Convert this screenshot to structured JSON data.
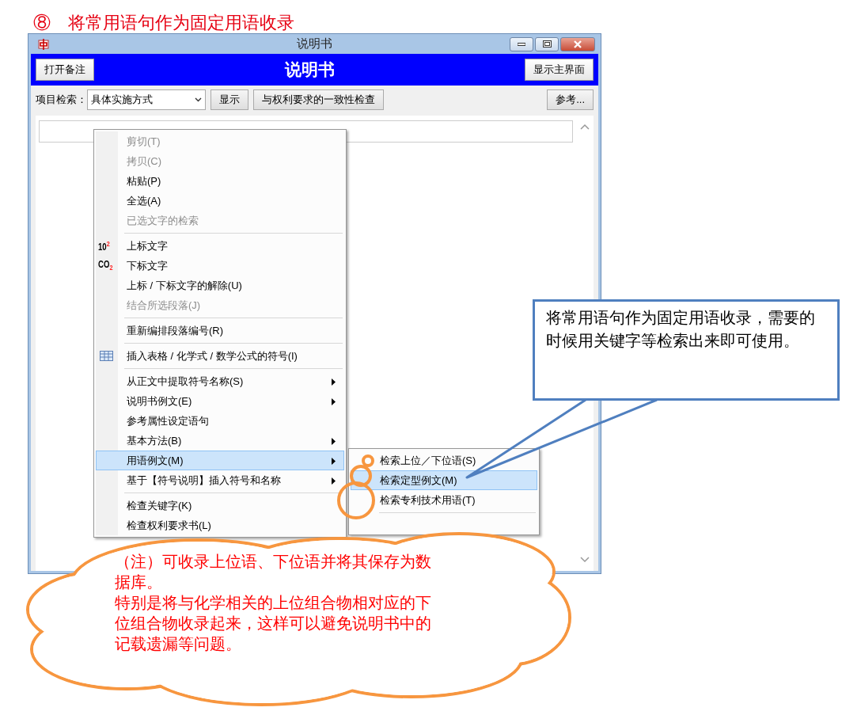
{
  "heading": "⑧　将常用语句作为固定用语收录",
  "window": {
    "title": "说明书"
  },
  "header": {
    "left_button": "打开备注",
    "title": "说明书",
    "right_button": "显示主界面"
  },
  "toolbar": {
    "label": "项目检索：",
    "select_value": "具体实施方式",
    "buttons": [
      "显示",
      "与权利要求的一致性检查"
    ],
    "right_button": "参考..."
  },
  "context_menu": {
    "items": [
      {
        "kind": "item",
        "label": "剪切(T)",
        "disabled": true,
        "submenu": false,
        "selected": false
      },
      {
        "kind": "item",
        "label": "拷贝(C)",
        "disabled": true,
        "submenu": false,
        "selected": false
      },
      {
        "kind": "item",
        "label": "粘贴(P)",
        "disabled": false,
        "submenu": false,
        "selected": false
      },
      {
        "kind": "item",
        "label": "全选(A)",
        "disabled": false,
        "submenu": false,
        "selected": false
      },
      {
        "kind": "item",
        "label": "已选文字的检索",
        "disabled": true,
        "submenu": false,
        "selected": false
      },
      {
        "kind": "separator"
      },
      {
        "kind": "item",
        "label": "上标文字",
        "disabled": false,
        "submenu": false,
        "selected": false,
        "icon_text": "10$^{2}$"
      },
      {
        "kind": "item",
        "label": "下标文字",
        "disabled": false,
        "submenu": false,
        "selected": false,
        "icon_text": "CO$_{2}$"
      },
      {
        "kind": "item",
        "label": "上标 / 下标文字的解除(U)",
        "disabled": false,
        "submenu": false,
        "selected": false
      },
      {
        "kind": "item",
        "label": "结合所选段落(J)",
        "disabled": true,
        "submenu": false,
        "selected": false
      },
      {
        "kind": "separator"
      },
      {
        "kind": "item",
        "label": "重新编排段落编号(R)",
        "disabled": false,
        "submenu": false,
        "selected": false
      },
      {
        "kind": "separator"
      },
      {
        "kind": "table_item",
        "label": "插入表格 / 化学式 / 数学公式的符号(I)",
        "disabled": false,
        "submenu": false,
        "selected": false
      },
      {
        "kind": "separator"
      },
      {
        "kind": "item",
        "label": "从正文中提取符号名称(S)",
        "disabled": false,
        "submenu": true,
        "selected": false
      },
      {
        "kind": "item",
        "label": "说明书例文(E)",
        "disabled": false,
        "submenu": true,
        "selected": false
      },
      {
        "kind": "item",
        "label": "参考属性设定语句",
        "disabled": false,
        "submenu": false,
        "selected": false
      },
      {
        "kind": "item",
        "label": "基本方法(B)",
        "disabled": false,
        "submenu": true,
        "selected": false
      },
      {
        "kind": "item",
        "label": "用语例文(M)",
        "disabled": false,
        "submenu": true,
        "selected": true
      },
      {
        "kind": "item",
        "label": "基于【符号说明】插入符号和名称",
        "disabled": false,
        "submenu": true,
        "selected": false
      },
      {
        "kind": "separator"
      },
      {
        "kind": "item",
        "label": "检查关键字(K)",
        "disabled": false,
        "submenu": false,
        "selected": false
      },
      {
        "kind": "item",
        "label": "检查权利要求书(L)",
        "disabled": false,
        "submenu": false,
        "selected": false
      }
    ]
  },
  "submenu": {
    "items": [
      {
        "kind": "item",
        "label": "检索上位／下位语(S)",
        "selected": false
      },
      {
        "kind": "item",
        "label": "检索定型例文(M)",
        "selected": true
      },
      {
        "kind": "item",
        "label": "检索专利技术用语(T)",
        "selected": false
      },
      {
        "kind": "separator"
      }
    ]
  },
  "callout": {
    "text": "将常用语句作为固定用语收录，需要的时候用关键字等检索出来即可使用。"
  },
  "cloud_note": {
    "lines": [
      "（注）可收录上位语、下位语并将其保存为数据库。",
      "特别是将与化学相关的上位组合物相对应的下位组合物收录起来，这样可以避免说明书中的记载遗漏等问题。"
    ]
  }
}
